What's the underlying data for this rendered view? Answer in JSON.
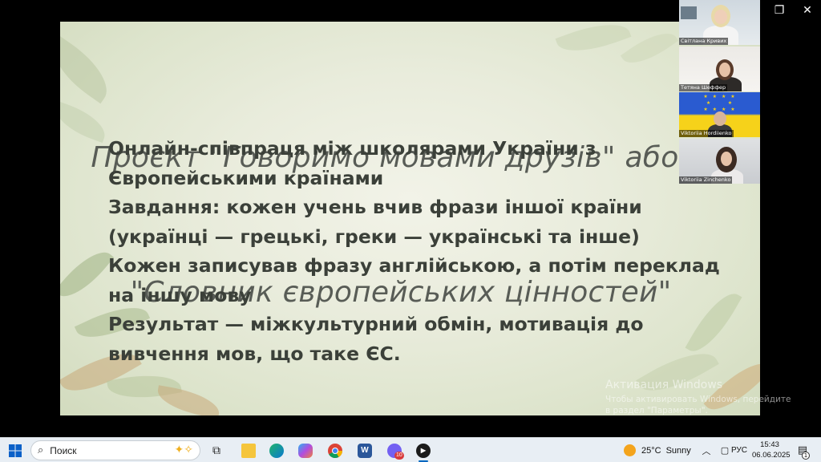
{
  "window": {
    "minimize_glyph": "—",
    "restore_glyph": "❐",
    "close_glyph": "✕"
  },
  "slide": {
    "title_line1": "Проєкт \"Говоримо мовами друзів\" або",
    "title_line2": "\"Словник європейських цінностей\"",
    "body": [
      " Онлайн-співпраця між школярами  України з",
      "Європейськими країнами",
      " Завдання: кожен учень вчив фрази іншої країни",
      "(українці — грецькі, греки — українські та інше)",
      "  Кожен записував фразу англійською, а потім переклад",
      "на іншу мову",
      "  Результат — міжкультурний обмін, мотивація до",
      "вивчення мов, що таке ЄС."
    ]
  },
  "watermark": {
    "title": "Активация Windows",
    "subtitle": "Чтобы активировать Windows, перейдите в раздел \"Параметры\"."
  },
  "participants": [
    {
      "name": "Світлана Кривих"
    },
    {
      "name": "Тетяна Шеффер"
    },
    {
      "name": "Viktoriia Hordiienko"
    },
    {
      "name": "Viktoriia Zinchenko"
    }
  ],
  "taskbar": {
    "search_placeholder": "Поиск",
    "apps": [
      {
        "icon": "task-view-icon"
      },
      {
        "icon": "file-explorer-icon"
      },
      {
        "icon": "edge-icon"
      },
      {
        "icon": "copilot-icon"
      },
      {
        "icon": "chrome-icon"
      },
      {
        "icon": "word-icon",
        "label": "W"
      },
      {
        "icon": "viber-icon",
        "badge": "10"
      },
      {
        "icon": "media-player-icon"
      }
    ],
    "weather_temp": "25°C",
    "weather_condition": "Sunny",
    "language": "РУС",
    "time": "15:43",
    "date": "06.06.2025",
    "notification_count": "1"
  },
  "colors": {
    "accent": "#0067c0",
    "slide_text": "#3b4039",
    "slide_title": "#585c56"
  }
}
